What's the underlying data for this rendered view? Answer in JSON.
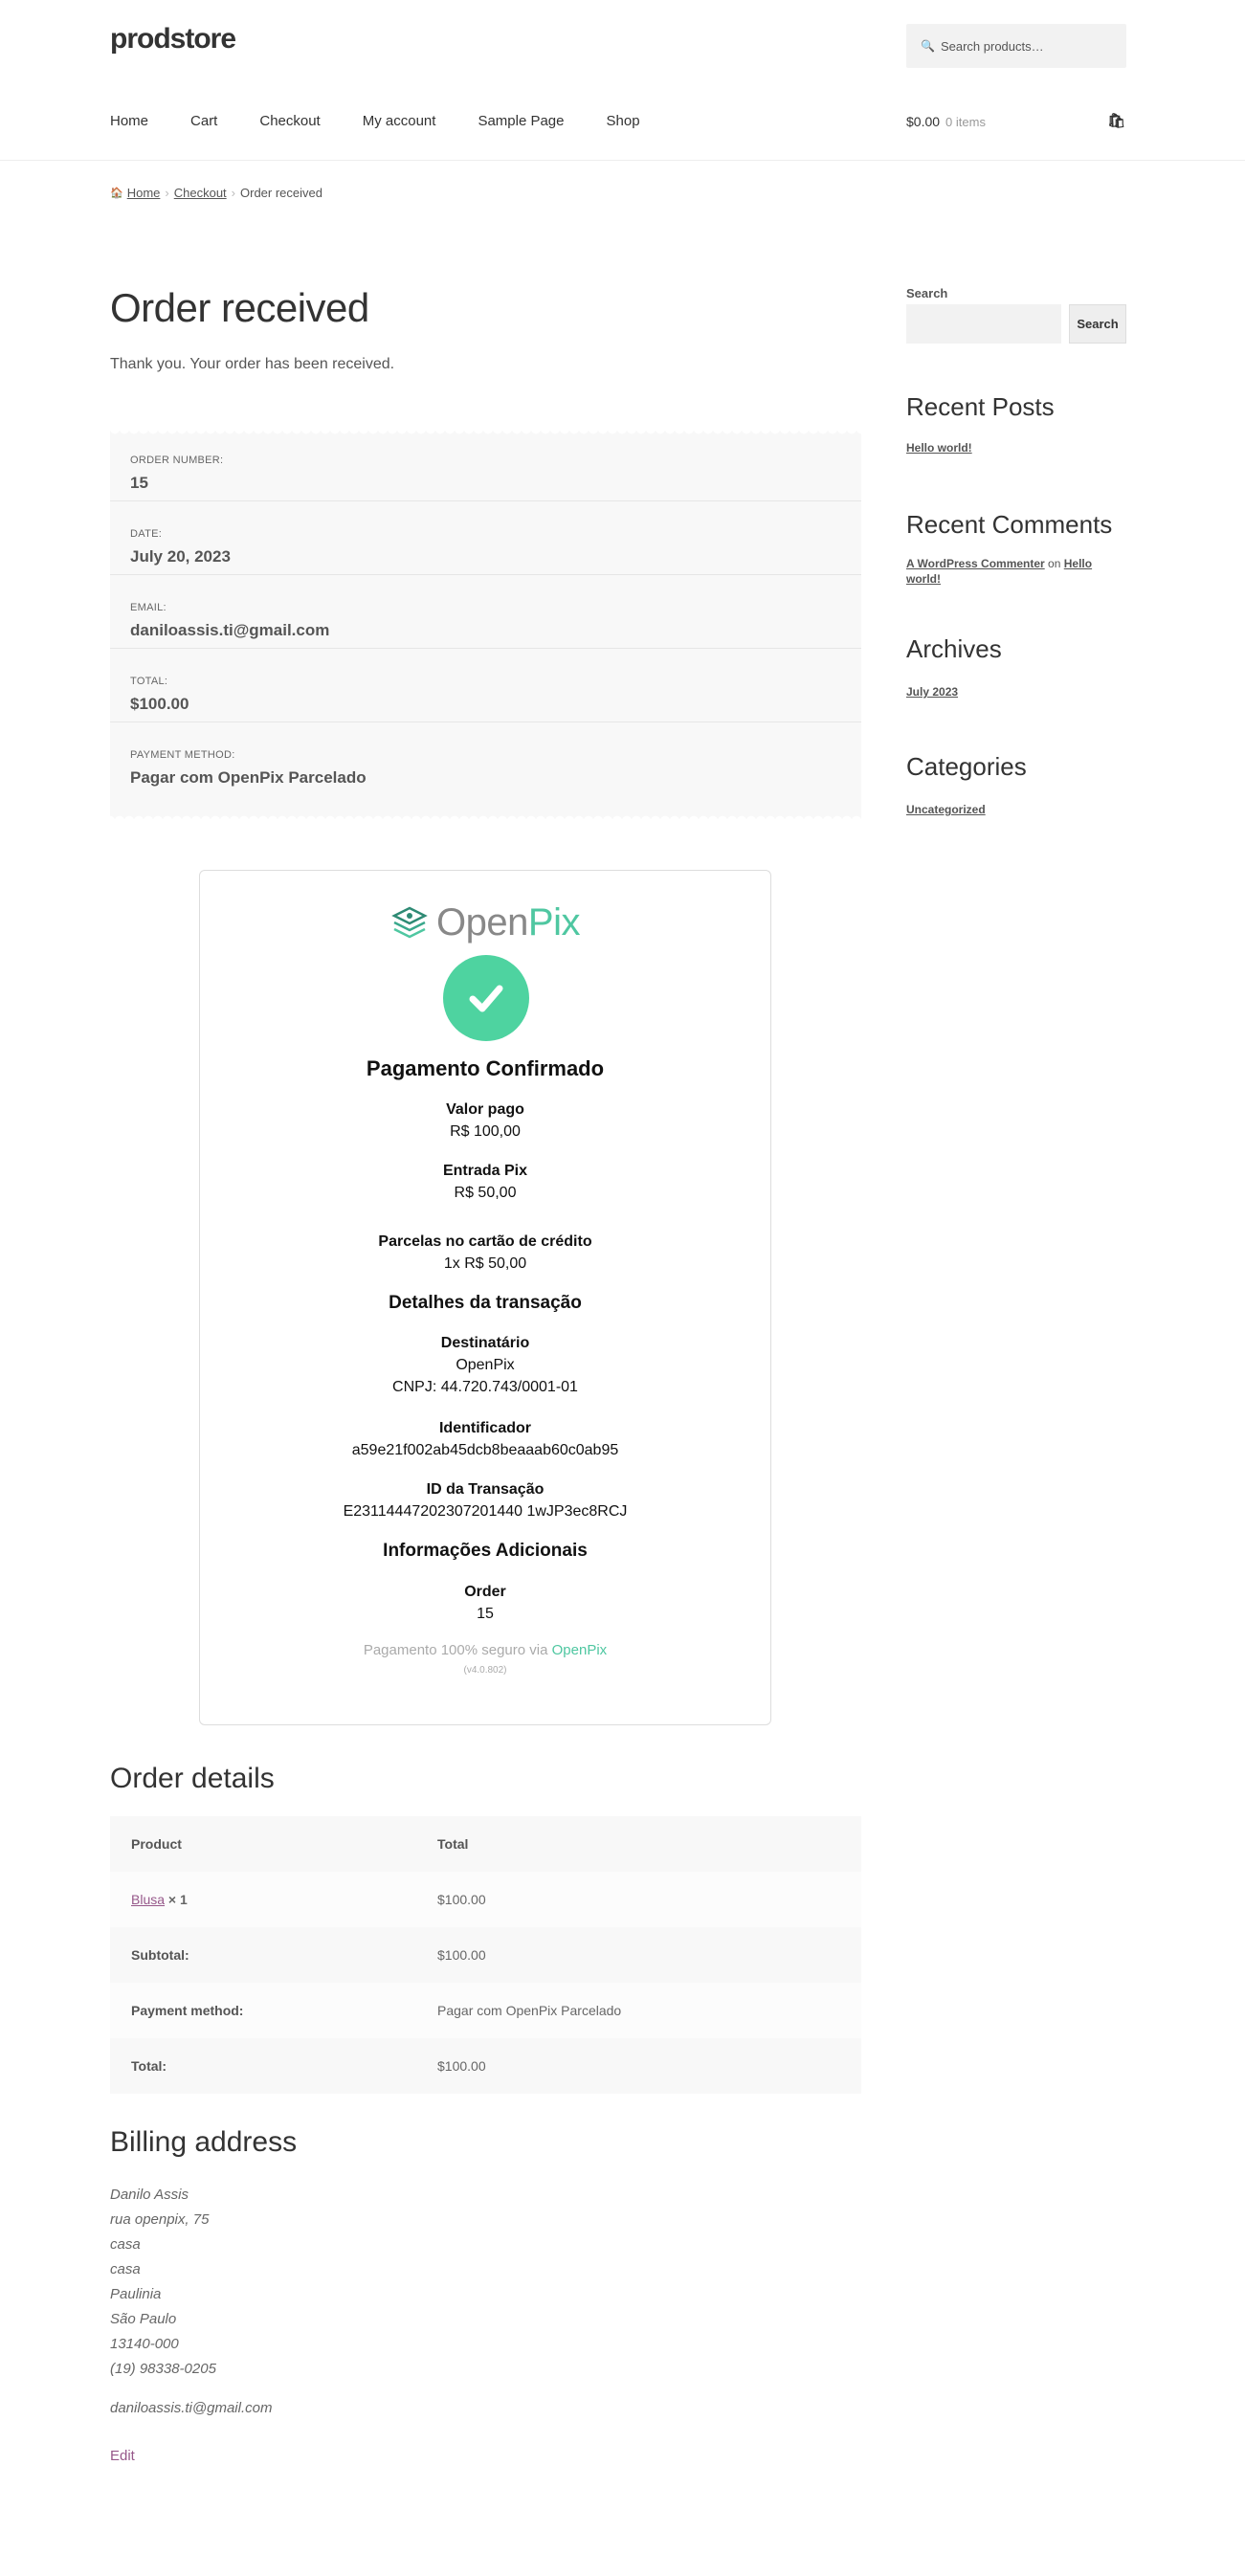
{
  "header": {
    "site_title": "prodstore",
    "search_placeholder": "Search products…",
    "search_icon": "🔍",
    "nav": [
      "Home",
      "Cart",
      "Checkout",
      "My account",
      "Sample Page",
      "Shop"
    ],
    "cart_total": "$0.00",
    "cart_items": "0 items",
    "cart_icon": "🛍"
  },
  "breadcrumb": {
    "home_icon": "🏠",
    "items": [
      "Home",
      "Checkout",
      "Order received"
    ]
  },
  "main": {
    "title": "Order received",
    "thankyou": "Thank you. Your order has been received.",
    "overview": [
      {
        "label": "Order number:",
        "value": "15"
      },
      {
        "label": "Date:",
        "value": "July 20, 2023"
      },
      {
        "label": "Email:",
        "value": "daniloassis.ti@gmail.com"
      },
      {
        "label": "Total:",
        "value": "$100.00"
      },
      {
        "label": "Payment method:",
        "value": "Pagar com OpenPix Parcelado"
      }
    ]
  },
  "openpix": {
    "logo_open": "Open",
    "logo_pix": "Pix",
    "title": "Pagamento Confirmado",
    "valor_pago_label": "Valor pago",
    "valor_pago": "R$ 100,00",
    "entrada_label": "Entrada Pix",
    "entrada": "R$ 50,00",
    "parcelas_label": "Parcelas no cartão de crédito",
    "parcelas": "1x R$ 50,00",
    "detalhes_title": "Detalhes da transação",
    "destinatario_label": "Destinatário",
    "destinatario_name": "OpenPix",
    "destinatario_cnpj": "CNPJ: 44.720.743/0001-01",
    "identificador_label": "Identificador",
    "identificador": "a59e21f002ab45dcb8beaaab60c0ab95",
    "id_transacao_label": "ID da Transação",
    "id_transacao": "E23114447202307201440 1wJP3ec8RCJ",
    "info_title": "Informações Adicionais",
    "order_label": "Order",
    "order_value": "15",
    "footer_text": "Pagamento 100% seguro via ",
    "footer_brand": "OpenPix",
    "version": "(v4.0.802)",
    "check_color": "#4ed3a0",
    "brand_color": "#4fc7a1"
  },
  "order_details": {
    "title": "Order details",
    "col_product": "Product",
    "col_total": "Total",
    "product_name": "Blusa",
    "product_qty": "× 1",
    "product_total": "$100.00",
    "subtotal_label": "Subtotal:",
    "subtotal": "$100.00",
    "payment_label": "Payment method:",
    "payment": "Pagar com OpenPix Parcelado",
    "total_label": "Total:",
    "total": "$100.00"
  },
  "billing": {
    "title": "Billing address",
    "lines": [
      "Danilo Assis",
      "rua openpix, 75",
      "casa",
      "casa",
      "Paulinia",
      "São Paulo",
      "13140-000",
      "(19) 98338-0205"
    ],
    "email": "daniloassis.ti@gmail.com",
    "edit": "Edit"
  },
  "sidebar": {
    "search_label": "Search",
    "search_button": "Search",
    "recent_posts_title": "Recent Posts",
    "recent_post": "Hello world!",
    "recent_comments_title": "Recent Comments",
    "comment_author": "A WordPress Commenter",
    "comment_on": "on",
    "comment_post": "Hello world!",
    "archives_title": "Archives",
    "archive": "July 2023",
    "categories_title": "Categories",
    "category": "Uncategorized"
  }
}
